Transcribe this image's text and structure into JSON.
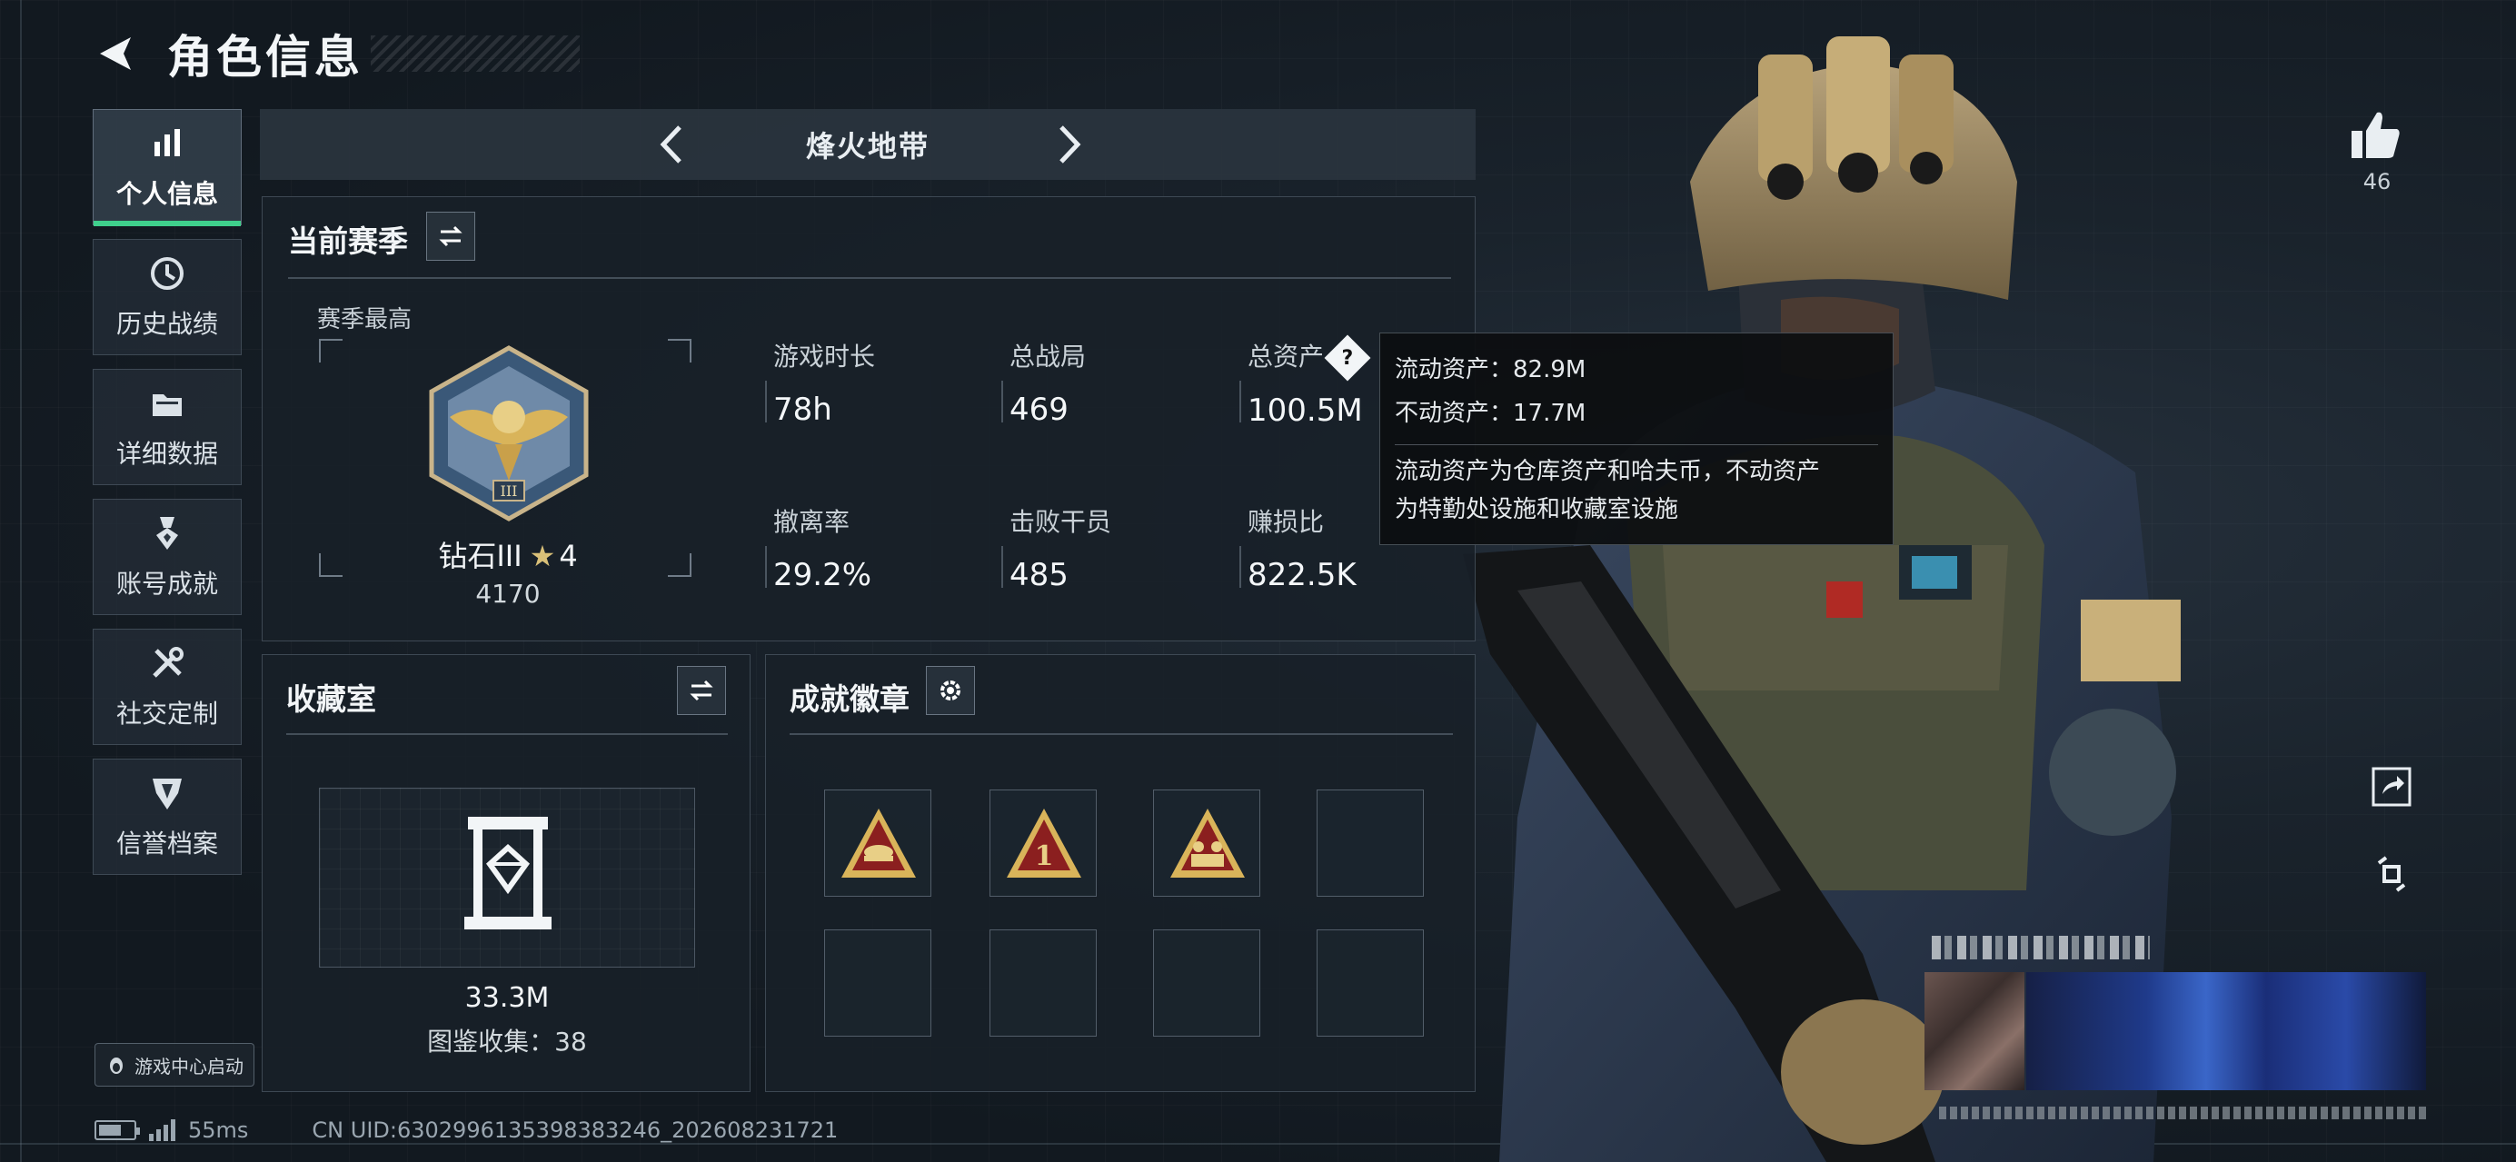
{
  "header": {
    "title": "角色信息"
  },
  "sidebar": {
    "items": [
      {
        "label": "个人信息",
        "icon": "bar-chart-icon",
        "active": true
      },
      {
        "label": "历史战绩",
        "icon": "history-icon",
        "active": false
      },
      {
        "label": "详细数据",
        "icon": "folder-icon",
        "active": false
      },
      {
        "label": "账号成就",
        "icon": "medal-icon",
        "active": false
      },
      {
        "label": "社交定制",
        "icon": "tools-icon",
        "active": false
      },
      {
        "label": "信誉档案",
        "icon": "shield-icon",
        "active": false
      }
    ],
    "game_center_label": "游戏中心启动"
  },
  "status": {
    "ping": "55ms",
    "uid": "CN UID:6302996135398383246_202608231721"
  },
  "mode": {
    "title": "烽火地带"
  },
  "season": {
    "title": "当前赛季",
    "best_label": "赛季最高",
    "rank_name": "钻石III",
    "rank_stars": "4",
    "rank_score": "4170",
    "stats": [
      {
        "label": "游戏时长",
        "value": "78h"
      },
      {
        "label": "总战局",
        "value": "469"
      },
      {
        "label": "总资产",
        "value": "100.5M"
      },
      {
        "label": "撤离率",
        "value": "29.2%"
      },
      {
        "label": "击败干员",
        "value": "485"
      },
      {
        "label": "赚损比",
        "value": "822.5K"
      }
    ]
  },
  "tooltip": {
    "liquid": "流动资产：82.9M",
    "fixed": "不动资产：17.7M",
    "desc_line1": "流动资产为仓库资产和哈夫币，不动资产",
    "desc_line2": "为特勤处设施和收藏室设施"
  },
  "collection": {
    "title": "收藏室",
    "value": "33.3M",
    "count": "图鉴收集：38"
  },
  "achievements": {
    "title": "成就徽章"
  },
  "social": {
    "likes": "46"
  },
  "colors": {
    "accent": "#3fd08c",
    "badge_gold": "#d9c078",
    "badge_red": "#8b1f1f"
  }
}
